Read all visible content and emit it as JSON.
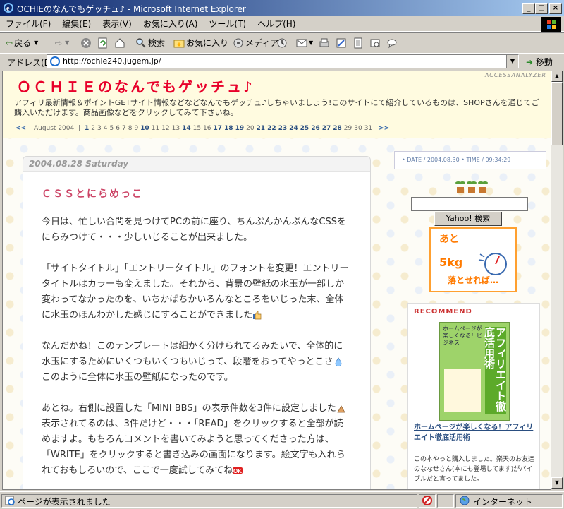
{
  "window": {
    "title": "OCHIEのなんでもゲッチュ♪ - Microsoft Internet Explorer",
    "controls": [
      "_",
      "□",
      "×"
    ]
  },
  "menu": [
    "ファイル(F)",
    "編集(E)",
    "表示(V)",
    "お気に入り(A)",
    "ツール(T)",
    "ヘルプ(H)"
  ],
  "toolbar": {
    "back": "戻る",
    "search": "検索",
    "favorites": "お気に入り",
    "media": "メディア"
  },
  "address": {
    "label": "アドレス(D)",
    "url": "http://ochie240.jugem.jp/",
    "go": "移動"
  },
  "site": {
    "title": "ＯＣＨＩＥのなんでもゲッチュ♪",
    "analyzer": "ACCESSANALYZER",
    "description": "アフィリ最新情報＆ポイントGETサイト情報などなどなんでもゲッチュ♪しちゃいましょう!このサイトにて紹介しているものは、SHOPさんを通じてご購入いただけます。商品画像などをクリックしてみて下さいね。"
  },
  "calendar": {
    "prev": "<<",
    "month": "August 2004",
    "sep": "|",
    "next": ">>",
    "days": [
      {
        "d": "1",
        "link": true
      },
      {
        "d": "2",
        "link": false
      },
      {
        "d": "3",
        "link": false
      },
      {
        "d": "4",
        "link": false
      },
      {
        "d": "5",
        "link": false
      },
      {
        "d": "6",
        "link": false
      },
      {
        "d": "7",
        "link": false
      },
      {
        "d": "8",
        "link": false
      },
      {
        "d": "9",
        "link": false
      },
      {
        "d": "10",
        "link": true
      },
      {
        "d": "11",
        "link": false
      },
      {
        "d": "12",
        "link": false
      },
      {
        "d": "13",
        "link": false
      },
      {
        "d": "14",
        "link": true
      },
      {
        "d": "15",
        "link": false
      },
      {
        "d": "16",
        "link": false
      },
      {
        "d": "17",
        "link": true
      },
      {
        "d": "18",
        "link": true
      },
      {
        "d": "19",
        "link": true
      },
      {
        "d": "20",
        "link": false
      },
      {
        "d": "21",
        "link": true
      },
      {
        "d": "22",
        "link": true
      },
      {
        "d": "23",
        "link": true
      },
      {
        "d": "24",
        "link": true
      },
      {
        "d": "25",
        "link": true
      },
      {
        "d": "26",
        "link": true
      },
      {
        "d": "27",
        "link": true
      },
      {
        "d": "28",
        "link": true
      },
      {
        "d": "29",
        "link": false
      },
      {
        "d": "30",
        "link": false
      },
      {
        "d": "31",
        "link": false
      }
    ]
  },
  "entry": {
    "date": "2004.08.28 Saturday",
    "title": "ＣＳＳとにらめっこ",
    "paragraphs": [
      "今日は、忙しい合間を見つけてPCの前に座り、ちんぷんかんぷんなCSSをにらみつけて・・・少しいじることが出来ました。",
      "「サイトタイトル」「エントリータイトル」のフォントを変更！エントリータイトルはカラーも変えました。それから、背景の壁紙の水玉が一部しか変わってなかったのを、いちかばちかいろんなところをいじった末、全体に水玉のほんわかした感じにすることができました",
      "なんだかね！このテンプレートは細かく分けられてるみたいで、全体的に水玉にするためにいくつもいくつもいじって、段階をおってやっとこさ",
      "このように全体に水玉の壁紙になったのです。",
      "あとね。右側に設置した「MINI BBS」の表示件数を3件に設定しました",
      "表示されてるのは、3件だけど・・・「READ」をクリックすると全部が読めますよ。もちろんコメントを書いてみようと思ってくださった方は、「WRITE」をクリックすると書き込みの画面になります。絵文字も入れられておもしろいので、ここで一度試してみてね"
    ]
  },
  "sidebar": {
    "datetime": "• DATE / 2004.08.30 • TIME / 09:34:29",
    "search_button": "Yahoo! 検索",
    "diet": {
      "line1": "あと",
      "line2": "5kg",
      "line3": "落とせれば…"
    },
    "recommend": {
      "heading": "RECOMMEND",
      "book_title": "アフィリエイト徹底活用術",
      "book_blurb": "ホームページが楽しくなる！ビジネス",
      "link": "ホームページが楽しくなる！アフィリエイト徹底活用術",
      "desc": "この本やっと購入しました。楽天のお友達のななせさん(本にも登場してます)がバイブルだと言ってました。"
    }
  },
  "status": {
    "text": "ページが表示されました",
    "zone": "インターネット"
  }
}
